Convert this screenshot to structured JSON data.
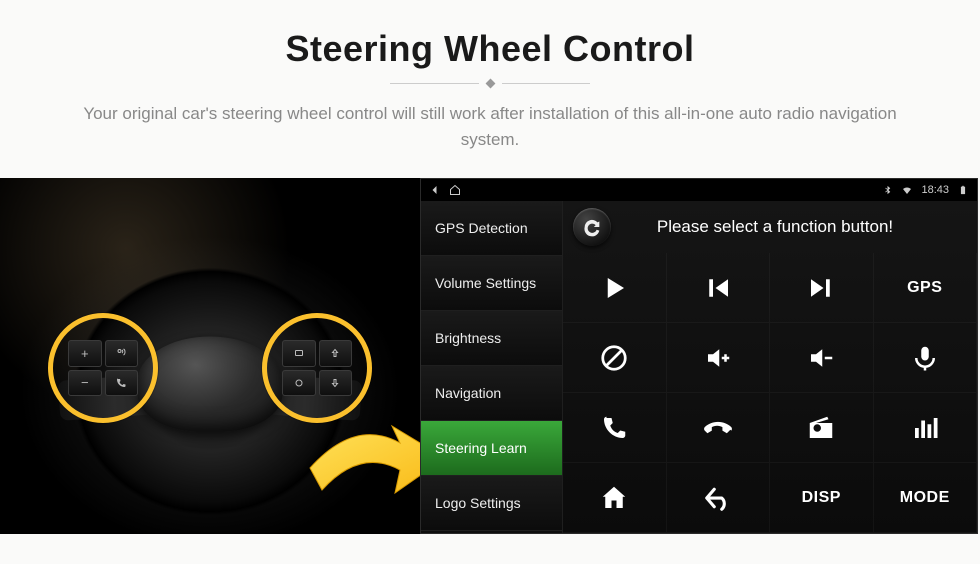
{
  "header": {
    "title": "Steering Wheel Control",
    "subtitle": "Your original car's steering wheel control will still work after installation of this all-in-one auto radio navigation system."
  },
  "status_bar": {
    "back_icon": "back",
    "home_icon": "home",
    "bluetooth_icon": "bluetooth",
    "wifi_icon": "wifi",
    "time": "18:43",
    "battery_icon": "battery"
  },
  "sidebar": {
    "items": [
      {
        "label": "GPS Detection"
      },
      {
        "label": "Volume Settings"
      },
      {
        "label": "Brightness"
      },
      {
        "label": "Navigation"
      },
      {
        "label": "Steering Learn"
      },
      {
        "label": "Logo Settings"
      }
    ],
    "selected_index": 4
  },
  "grid": {
    "title": "Please select a function button!",
    "buttons": [
      {
        "icon": "play",
        "name": "play-button"
      },
      {
        "icon": "prev",
        "name": "previous-track-button"
      },
      {
        "icon": "next",
        "name": "next-track-button"
      },
      {
        "label": "GPS",
        "name": "gps-button"
      },
      {
        "icon": "mute",
        "name": "mute-button"
      },
      {
        "icon": "vol-up",
        "name": "volume-up-button"
      },
      {
        "icon": "vol-down",
        "name": "volume-down-button"
      },
      {
        "icon": "mic",
        "name": "mic-button"
      },
      {
        "icon": "call",
        "name": "call-pickup-button"
      },
      {
        "icon": "hangup",
        "name": "call-hangup-button"
      },
      {
        "icon": "radio",
        "name": "radio-button"
      },
      {
        "icon": "eq",
        "name": "equalizer-button"
      },
      {
        "icon": "home-app",
        "name": "home-button"
      },
      {
        "icon": "back-arrow",
        "name": "back-button"
      },
      {
        "label": "DISP",
        "name": "display-button"
      },
      {
        "label": "MODE",
        "name": "mode-button"
      }
    ]
  },
  "wheel_buttons": {
    "left": [
      "plus",
      "voice",
      "minus",
      "phone"
    ],
    "right": [
      "source",
      "up",
      "cycle",
      "down"
    ]
  }
}
